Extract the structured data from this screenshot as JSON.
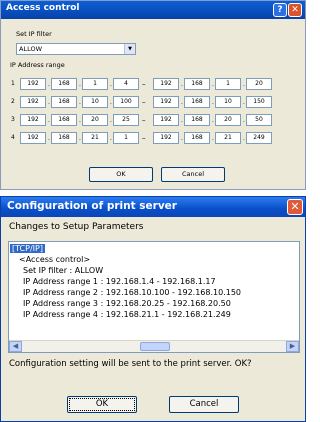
{
  "access_dialog": {
    "title": "Access control",
    "help_label": "?",
    "close_label": "✕",
    "set_ip_filter_label": "Set IP filter",
    "ip_filter_value": "ALLOW",
    "ip_range_label": "IP Address range",
    "ranges": [
      {
        "num": "1",
        "start": [
          "192",
          "168",
          "1",
          "4"
        ],
        "end": [
          "192",
          "168",
          "1",
          "20"
        ]
      },
      {
        "num": "2",
        "start": [
          "192",
          "168",
          "10",
          "100"
        ],
        "end": [
          "192",
          "168",
          "10",
          "150"
        ]
      },
      {
        "num": "3",
        "start": [
          "192",
          "168",
          "20",
          "25"
        ],
        "end": [
          "192",
          "168",
          "20",
          "50"
        ]
      },
      {
        "num": "4",
        "start": [
          "192",
          "168",
          "21",
          "1"
        ],
        "end": [
          "192",
          "168",
          "21",
          "249"
        ]
      }
    ],
    "ok_label": "OK",
    "cancel_label": "Cancel"
  },
  "config_dialog": {
    "title": "Configuration of print server",
    "close_label": "✕",
    "subtitle": "Changes to Setup Parameters",
    "list_lines": [
      "[TCP/IP]",
      "<Access control>",
      "Set IP filter : ALLOW",
      "IP Address range 1 : 192.168.1.4 - 192.168.1.17",
      "IP Address range 2 : 192.168.10.100 - 192.168.10.150",
      "IP Address range 3 : 192.168.20.25 - 192.168.20.50",
      "IP Address range 4 : 192.168.21.1 - 192.168.21.249"
    ],
    "message": "Configuration setting will be sent to the print server. OK?",
    "ok_label": "OK",
    "cancel_label": "Cancel"
  }
}
